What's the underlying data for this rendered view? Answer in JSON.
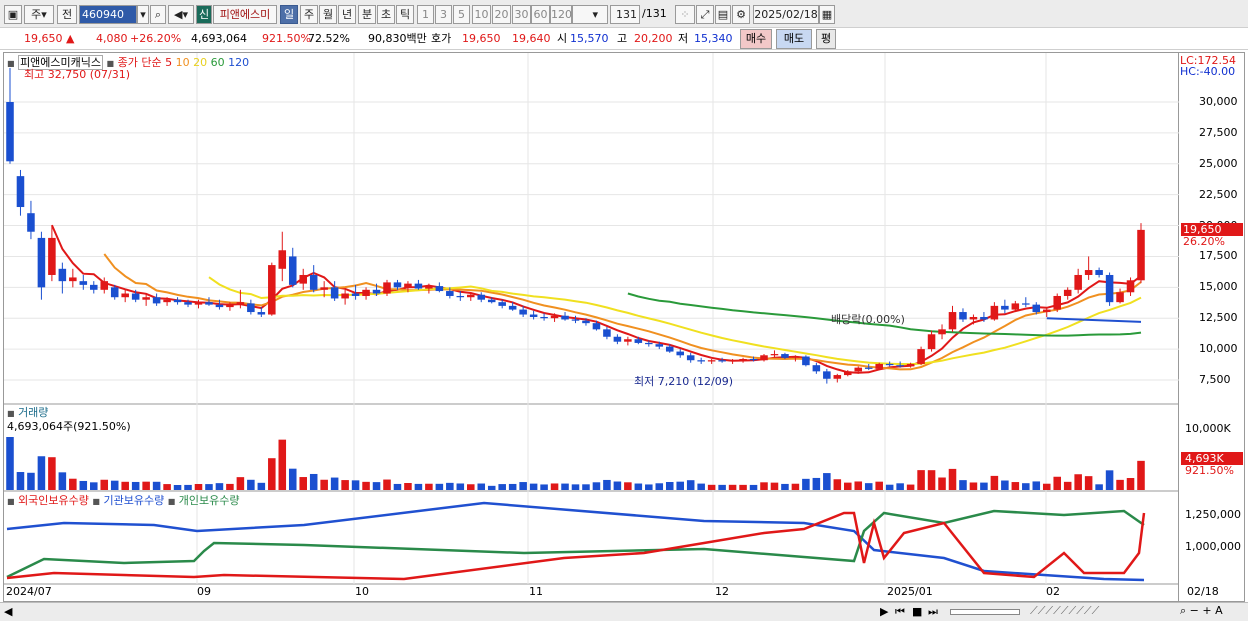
{
  "toolbar": {
    "period_label": "주",
    "prev_label": "전",
    "code_value": "460940",
    "new_badge": "신",
    "stock_name": "피앤에스미",
    "tabs": [
      "일",
      "주",
      "월",
      "년",
      "분",
      "초",
      "틱"
    ],
    "active_tab": "일",
    "intervals": [
      "1",
      "3",
      "5",
      "10",
      "20",
      "30",
      "60",
      "120"
    ],
    "count_value": "131",
    "count_total": "/131",
    "date_value": "2025/02/18"
  },
  "quote": {
    "price": "19,650",
    "arrow": "▲",
    "change": "4,080",
    "change_pct": "+26.20%",
    "volume": "4,693,064",
    "vol_ratio": "921.50%",
    "turnover": "72.52%",
    "amount": "90,830백만",
    "hoga_label": "호가",
    "ask": "19,650",
    "bid": "19,640",
    "open_label": "시",
    "open": "15,570",
    "high_label": "고",
    "high": "20,200",
    "low_label": "저",
    "low": "15,340",
    "buy_label": "매수",
    "sell_label": "매도",
    "eval_label": "평"
  },
  "price_pane": {
    "stock_label": "피앤에스미캐닉스",
    "ma_title": "종가 단순",
    "ma_periods": [
      "5",
      "10",
      "20",
      "60",
      "120"
    ],
    "ma_colors": [
      "#e01818",
      "#f09020",
      "#f0e020",
      "#2a9a3a",
      "#2050d0"
    ],
    "high_note": "최고 32,750 (07/31)",
    "low_note": "최저 7,210 (12/09)",
    "dividend_note": "배당락(0.00%)",
    "lc": "LC:172.54",
    "hc": "HC:-40.00",
    "y_ticks": [
      "30,000",
      "27,500",
      "25,000",
      "22,500",
      "20,000",
      "17,500",
      "15,000",
      "12,500",
      "10,000",
      "7,500"
    ],
    "current_price": "19,650",
    "current_pct": "26.20%"
  },
  "volume_pane": {
    "title": "거래량",
    "value_note": "4,693,064주(921.50%)",
    "y_tick": "10,000K",
    "current_vol": "4,693K",
    "current_pct": "921.50%"
  },
  "holdings_pane": {
    "series": [
      "외국인보유수량",
      "기관보유수량",
      "개인보유수량"
    ],
    "colors": [
      "#e01818",
      "#2050d0",
      "#2a8a4a"
    ],
    "y_ticks": [
      "1,250,000",
      "1,000,000"
    ]
  },
  "x_axis": {
    "labels": [
      "2024/07",
      "09",
      "10",
      "11",
      "12",
      "2025/01",
      "02",
      "02/18"
    ]
  },
  "chart_data": {
    "type": "candlestick",
    "title": "피앤에스미캐닉스",
    "ylim": [
      5500,
      33000
    ],
    "candles": [
      [
        30000,
        32750,
        25000,
        25200
      ],
      [
        24000,
        24500,
        20800,
        21500
      ],
      [
        21000,
        22000,
        18900,
        19500
      ],
      [
        19000,
        19500,
        14000,
        15000
      ],
      [
        16000,
        20000,
        15500,
        19000
      ],
      [
        16500,
        17000,
        14500,
        15500
      ],
      [
        15500,
        16500,
        15000,
        15800
      ],
      [
        15500,
        16000,
        14800,
        15200
      ],
      [
        15200,
        15500,
        14500,
        14800
      ],
      [
        14800,
        15800,
        14500,
        15500
      ],
      [
        15000,
        15200,
        14000,
        14200
      ],
      [
        14200,
        14800,
        13800,
        14500
      ],
      [
        14500,
        14800,
        13800,
        14000
      ],
      [
        14000,
        14500,
        13500,
        14200
      ],
      [
        14200,
        14500,
        13500,
        13700
      ],
      [
        13800,
        14200,
        13500,
        14000
      ],
      [
        14000,
        14200,
        13600,
        13800
      ],
      [
        13800,
        14000,
        13400,
        13600
      ],
      [
        13600,
        14000,
        13300,
        13800
      ],
      [
        13800,
        14200,
        13500,
        13600
      ],
      [
        13600,
        14000,
        13200,
        13400
      ],
      [
        13400,
        13800,
        13100,
        13600
      ],
      [
        13600,
        14800,
        13300,
        13800
      ],
      [
        13700,
        14000,
        12800,
        13000
      ],
      [
        13000,
        13400,
        12600,
        12800
      ],
      [
        12800,
        17000,
        12700,
        16800
      ],
      [
        16500,
        19500,
        15500,
        18000
      ],
      [
        17500,
        18200,
        15000,
        15200
      ],
      [
        15300,
        16500,
        14800,
        16000
      ],
      [
        16000,
        16800,
        14600,
        14800
      ],
      [
        14800,
        15500,
        14200,
        15000
      ],
      [
        15000,
        15500,
        13900,
        14100
      ],
      [
        14100,
        14800,
        13600,
        14500
      ],
      [
        14500,
        15200,
        14000,
        14300
      ],
      [
        14300,
        15000,
        14000,
        14800
      ],
      [
        14800,
        15300,
        14300,
        14500
      ],
      [
        14500,
        15600,
        14300,
        15400
      ],
      [
        15400,
        15600,
        14800,
        15000
      ],
      [
        15000,
        15500,
        14600,
        15300
      ],
      [
        15300,
        15600,
        14800,
        14900
      ],
      [
        14900,
        15300,
        14500,
        15100
      ],
      [
        15100,
        15400,
        14600,
        14700
      ],
      [
        14700,
        15000,
        14100,
        14300
      ],
      [
        14300,
        14700,
        13900,
        14200
      ],
      [
        14200,
        14600,
        13900,
        14400
      ],
      [
        14400,
        14600,
        13800,
        14000
      ],
      [
        14000,
        14200,
        13700,
        13800
      ],
      [
        13800,
        14000,
        13300,
        13500
      ],
      [
        13500,
        13800,
        13100,
        13200
      ],
      [
        13200,
        13500,
        12600,
        12800
      ],
      [
        12800,
        13100,
        12400,
        12600
      ],
      [
        12600,
        12900,
        12300,
        12500
      ],
      [
        12500,
        12900,
        12200,
        12700
      ],
      [
        12700,
        13000,
        12300,
        12400
      ],
      [
        12400,
        12700,
        12100,
        12300
      ],
      [
        12300,
        12500,
        11900,
        12100
      ],
      [
        12100,
        12300,
        11500,
        11600
      ],
      [
        11600,
        11800,
        10800,
        11000
      ],
      [
        11000,
        11200,
        10400,
        10600
      ],
      [
        10600,
        11000,
        10300,
        10800
      ],
      [
        10800,
        11000,
        10400,
        10500
      ],
      [
        10500,
        10700,
        10200,
        10400
      ],
      [
        10400,
        10600,
        10000,
        10200
      ],
      [
        10200,
        10400,
        9700,
        9800
      ],
      [
        9800,
        10000,
        9300,
        9500
      ],
      [
        9500,
        9700,
        8900,
        9100
      ],
      [
        9100,
        9300,
        8800,
        9000
      ],
      [
        9000,
        9200,
        8800,
        9100
      ],
      [
        9100,
        9300,
        8900,
        9000
      ],
      [
        9000,
        9200,
        8800,
        9100
      ],
      [
        9100,
        9300,
        8900,
        9200
      ],
      [
        9200,
        9400,
        9000,
        9100
      ],
      [
        9100,
        9600,
        9000,
        9500
      ],
      [
        9500,
        9900,
        9300,
        9600
      ],
      [
        9600,
        9700,
        9200,
        9300
      ],
      [
        9300,
        9500,
        9000,
        9400
      ],
      [
        9400,
        9500,
        8600,
        8700
      ],
      [
        8700,
        8900,
        8000,
        8200
      ],
      [
        8200,
        8400,
        7210,
        7600
      ],
      [
        7600,
        8000,
        7300,
        7900
      ],
      [
        7900,
        8300,
        7800,
        8200
      ],
      [
        8200,
        8600,
        8000,
        8500
      ],
      [
        8500,
        8800,
        8300,
        8400
      ],
      [
        8400,
        8900,
        8300,
        8800
      ],
      [
        8800,
        9000,
        8600,
        8700
      ],
      [
        8700,
        9000,
        8500,
        8600
      ],
      [
        8600,
        8900,
        8500,
        8800
      ],
      [
        8800,
        10200,
        8700,
        10000
      ],
      [
        10000,
        11500,
        9800,
        11200
      ],
      [
        11200,
        12000,
        10800,
        11600
      ],
      [
        11600,
        13500,
        11400,
        13000
      ],
      [
        13000,
        13300,
        12200,
        12400
      ],
      [
        12400,
        12800,
        12000,
        12600
      ],
      [
        12600,
        13000,
        12200,
        12400
      ],
      [
        12400,
        13800,
        12300,
        13500
      ],
      [
        13500,
        14000,
        12900,
        13200
      ],
      [
        13200,
        13900,
        13000,
        13700
      ],
      [
        13700,
        14200,
        13400,
        13600
      ],
      [
        13600,
        13800,
        12800,
        13000
      ],
      [
        13000,
        13300,
        12600,
        13200
      ],
      [
        13200,
        14500,
        13000,
        14300
      ],
      [
        14300,
        15000,
        14000,
        14800
      ],
      [
        14800,
        16500,
        14500,
        16000
      ],
      [
        16000,
        17500,
        15600,
        16400
      ],
      [
        16400,
        16600,
        15800,
        16000
      ],
      [
        16000,
        16200,
        13500,
        13800
      ],
      [
        13800,
        14900,
        13700,
        14600
      ],
      [
        14600,
        15800,
        14300,
        15570
      ],
      [
        15570,
        20200,
        15340,
        19650
      ]
    ],
    "ma5_note": "ma lines drawn from close values"
  }
}
